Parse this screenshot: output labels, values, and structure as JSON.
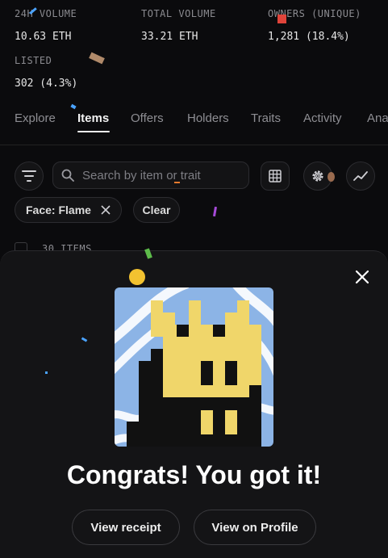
{
  "stats": [
    {
      "label": "24H VOLUME",
      "value": "10.63 ETH"
    },
    {
      "label": "TOTAL VOLUME",
      "value": "33.21 ETH"
    },
    {
      "label": "OWNERS (UNIQUE)",
      "value": "1,281 (18.4%)"
    },
    {
      "label": "LISTED",
      "value": "302 (4.3%)"
    }
  ],
  "tabs": [
    "Explore",
    "Items",
    "Offers",
    "Holders",
    "Traits",
    "Activity",
    "Ana"
  ],
  "active_tab": "Items",
  "search": {
    "placeholder": "Search by item or trait"
  },
  "filters": {
    "chip_label": "Face: Flame",
    "clear_label": "Clear"
  },
  "items": {
    "count_label": "30 ITEMS"
  },
  "modal": {
    "title": "Congrats! You got it!",
    "receipt_button": "View receipt",
    "profile_button": "View on Profile"
  },
  "icons": [
    "filter-icon",
    "search-icon",
    "grid-icon",
    "gear-icon",
    "trend-icon",
    "close-icon",
    "chip-close-icon"
  ],
  "colors": {
    "background": "#0b0b0d",
    "sheet": "#141416",
    "art_bg": "#8cb4e6",
    "art_yellow": "#f0d66a",
    "art_black": "#111111"
  }
}
